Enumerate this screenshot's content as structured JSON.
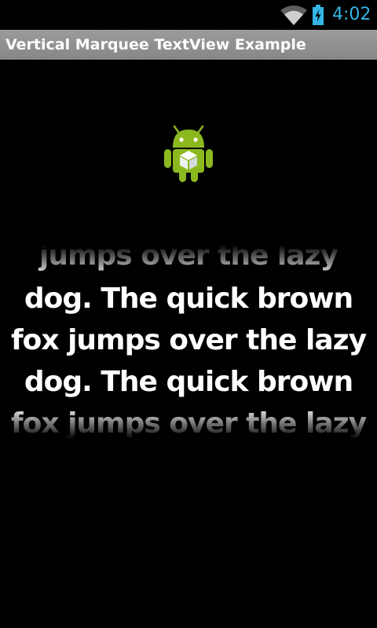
{
  "status_bar": {
    "time": "4:02",
    "time_color": "#33b5e5",
    "icons": [
      "wifi-icon",
      "battery-charging-icon"
    ]
  },
  "action_bar": {
    "title": "Vertical Marquee TextView Example"
  },
  "app_icon": "android-robot-icon",
  "marquee": {
    "lines": [
      "jumps over the lazy",
      "dog. The quick brown",
      "fox jumps over the lazy",
      "dog. The quick brown",
      "fox jumps over the lazy"
    ]
  }
}
